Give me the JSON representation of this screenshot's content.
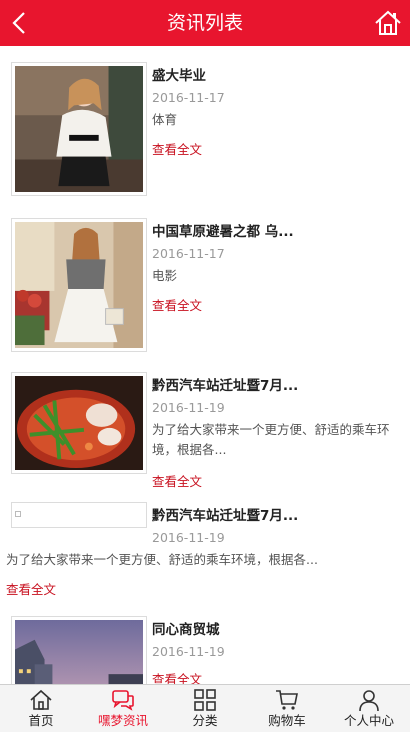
{
  "header": {
    "title": "资讯列表",
    "back_icon": "chevron-left-icon",
    "home_icon": "home-icon",
    "background": "#e8152e"
  },
  "articles": [
    {
      "title": "盛大毕业",
      "date": "2016-11-17",
      "category": "体育",
      "more": "查看全文"
    },
    {
      "title": "中国草原避暑之都 乌...",
      "date": "2016-11-17",
      "category": "电影",
      "more": "查看全文"
    },
    {
      "title": "黔西汽车站迁址暨7月...",
      "date": "2016-11-19",
      "desc": "为了给大家带来一个更方便、舒适的乘车环境，根据各...",
      "more": "查看全文"
    },
    {
      "title": "黔西汽车站迁址暨7月...",
      "date": "2016-11-19",
      "desc": "为了给大家带来一个更方便、舒适的乘车环境，根据各...",
      "more": "查看全文"
    },
    {
      "title": "同心商贸城",
      "date": "2016-11-19",
      "more": "查看全文"
    }
  ],
  "tabs": [
    {
      "label": "首页",
      "icon": "home-icon",
      "active": false
    },
    {
      "label": "嘿梦资讯",
      "icon": "chat-icon",
      "active": true
    },
    {
      "label": "分类",
      "icon": "grid-icon",
      "active": false
    },
    {
      "label": "购物车",
      "icon": "cart-icon",
      "active": false
    },
    {
      "label": "个人中心",
      "icon": "user-icon",
      "active": false
    }
  ],
  "colors": {
    "accent": "#e8152e",
    "link": "#c8101f"
  }
}
